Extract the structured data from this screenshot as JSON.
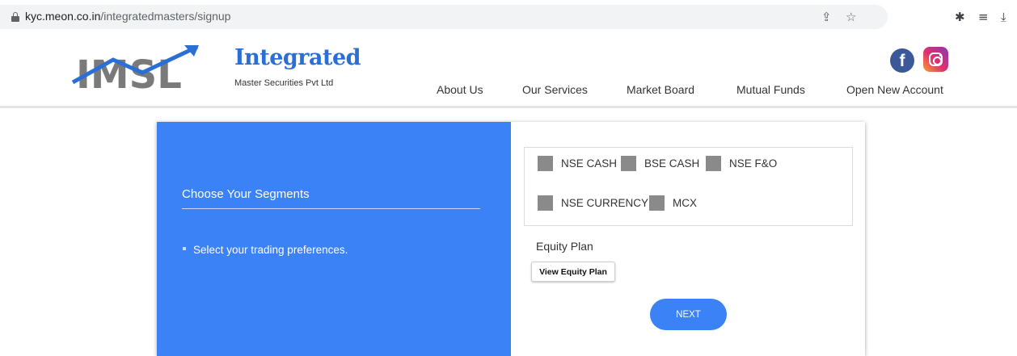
{
  "browser": {
    "url_host": "kyc.meon.co.in",
    "url_path": "/integratedmasters/signup"
  },
  "header": {
    "logo_text": "IMSL",
    "brand_title": "Integrated",
    "brand_subtitle": "Master Securities Pvt Ltd",
    "nav": [
      "About Us",
      "Our Services",
      "Market Board",
      "Mutual Funds",
      "Open New Account"
    ]
  },
  "left_panel": {
    "title": "Choose Your Segments",
    "bullet": "Select your trading preferences."
  },
  "segments": [
    {
      "label": "NSE CASH",
      "checked": false
    },
    {
      "label": "BSE CASH",
      "checked": false
    },
    {
      "label": "NSE F&O",
      "checked": false
    },
    {
      "label": "NSE CURRENCY",
      "checked": false
    },
    {
      "label": "MCX",
      "checked": false
    }
  ],
  "equity": {
    "label": "Equity Plan",
    "button": "View Equity Plan"
  },
  "next_button": "NEXT",
  "colors": {
    "accent": "#3b82f6",
    "brand": "#2a6fd6",
    "checkbox": "#8a8a8a",
    "facebook": "#3b5998"
  }
}
